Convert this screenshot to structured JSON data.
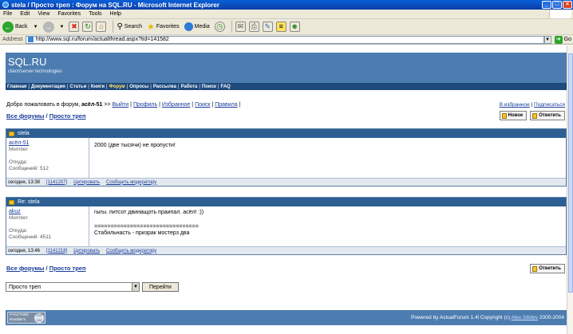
{
  "window": {
    "title": "stela / Просто треп : Форум на SQL.RU - Microsoft Internet Explorer",
    "controls": [
      "_",
      "□",
      "×"
    ]
  },
  "menubar": [
    "File",
    "Edit",
    "View",
    "Favorites",
    "Tools",
    "Help"
  ],
  "toolbar": {
    "back": "Back",
    "search": "Search",
    "favorites": "Favorites",
    "media": "Media"
  },
  "address": {
    "label": "Address",
    "url": "http://www.sql.ru/forum/actualthread.aspx?tid=141582",
    "go": "Go"
  },
  "site": {
    "logo": "SQL.RU",
    "tagline": "client/server technologies",
    "nav": [
      "Главная",
      "Документация",
      "Статьи",
      "Книги",
      "Форум",
      "Опросы",
      "Рассылка",
      "Работа",
      "Поиск",
      "FAQ"
    ],
    "nav_active_index": 4
  },
  "welcome": {
    "prefix": "Добро пожаловать в форум,",
    "user": "асёл-51",
    "arrows": ">>",
    "links": [
      "Выйти",
      "Профиль",
      "Избранное",
      "Поиск",
      "Правила"
    ],
    "right_links": [
      "В избранное",
      "Подписаться"
    ]
  },
  "breadcrumb": {
    "all": "Все форумы",
    "sep": "/",
    "current": "Просто треп"
  },
  "buttons": {
    "new": "Новое",
    "reply": "Ответить",
    "go": "Перейти"
  },
  "posts": [
    {
      "subject": "stela",
      "author": "асёл-51",
      "role": "Member",
      "from_label": "Откуда:",
      "count_label": "Сообщений: 512",
      "lines": [
        "2000 (две тысячи) не пропусти!"
      ],
      "date": "сегодня, 13:38",
      "msg_id": "[1141207]",
      "quote": "Цитировать",
      "notify": "Сообщить модератору"
    },
    {
      "subject": "Re: stela",
      "author": "akuz",
      "role": "Member",
      "from_label": "Откуда:",
      "count_label": "Сообщений: 4511",
      "lines": [
        "гыгы. питсот двинащоть праипал. асёл! :))",
        "",
        "================================",
        "Стабильнасть - призрак мостерз два"
      ],
      "date": "сегодня, 13:46",
      "msg_id": "[1141218]",
      "quote": "Цитировать",
      "notify": "Сообщить модератору"
    }
  ],
  "select": {
    "value": "Просто треп"
  },
  "footer": {
    "badge_text": "УЧАСТНИК Rambler's",
    "badge_top": "TOP 100",
    "powered": "Powered by ActualForum 1.4l Copyright (c)",
    "author": "Alex Sibilev",
    "years": "2000-2004"
  }
}
